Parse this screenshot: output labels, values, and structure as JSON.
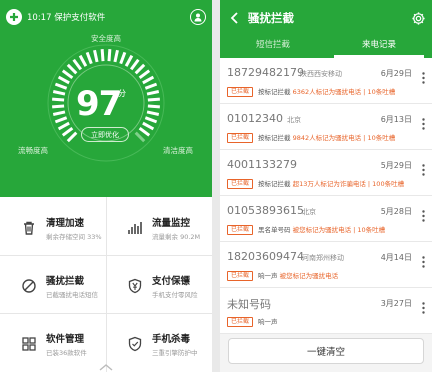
{
  "left": {
    "status_text": "10:17 保护支付软件",
    "gauge": {
      "top_label": "安全度高",
      "left_label": "流畅度高",
      "right_label": "清洁度高",
      "score": "97",
      "unit": "分",
      "score_fraction": 0.97
    },
    "optimize_label": "立即优化",
    "tiles": [
      {
        "title": "清理加速",
        "sub": "剩余存储空间 33%",
        "icon": "trash-icon"
      },
      {
        "title": "流量监控",
        "sub": "流量剩余 90.2M",
        "icon": "signal-bars-icon"
      },
      {
        "title": "骚扰拦截",
        "sub": "已截骚扰电话短信",
        "icon": "block-icon"
      },
      {
        "title": "支付保镖",
        "sub": "手机支付零风险",
        "icon": "yen-shield-icon"
      },
      {
        "title": "软件管理",
        "sub": "已装36款软件",
        "icon": "apps-grid-icon"
      },
      {
        "title": "手机杀毒",
        "sub": "三重引擎防护中",
        "icon": "shield-icon"
      }
    ]
  },
  "right": {
    "title": "骚扰拦截",
    "tabs": [
      {
        "label": "短信拦截",
        "active": false
      },
      {
        "label": "来电记录",
        "active": true
      }
    ],
    "records": [
      {
        "number": "18729482179",
        "location": "陕西西安移动",
        "date": "6月29日",
        "badge": "已拦截",
        "desc": "按标记拦截 ",
        "highlight": "6362人标记为骚扰电话 | 10条吐槽"
      },
      {
        "number": "01012340",
        "location": "北京",
        "date": "6月13日",
        "badge": "已拦截",
        "desc": "按标记拦截 ",
        "highlight": "9842人标记为骚扰电话 | 10条吐槽"
      },
      {
        "number": "4001133279",
        "location": "",
        "date": "5月29日",
        "badge": "已拦截",
        "desc": "按标记拦截 ",
        "highlight": "超13万人标记为诈骗电话 | 100条吐槽"
      },
      {
        "number": "01053893615",
        "location": "北京",
        "date": "5月28日",
        "badge": "已拦截",
        "desc": "黑名单号码 ",
        "highlight": "被您标记为骚扰电话 | 10条吐槽"
      },
      {
        "number": "18203609474",
        "location": "河南郑州移动",
        "date": "4月14日",
        "badge": "已拦截",
        "desc": "响一声 ",
        "highlight": "被您标记为骚扰电话"
      },
      {
        "number": "未知号码",
        "location": "",
        "date": "3月27日",
        "badge": "已拦截",
        "desc": "响一声",
        "highlight": ""
      }
    ],
    "clear_label": "一键清空"
  },
  "colors": {
    "brand_green": "#27a73a",
    "warn_orange": "#e8642a"
  }
}
